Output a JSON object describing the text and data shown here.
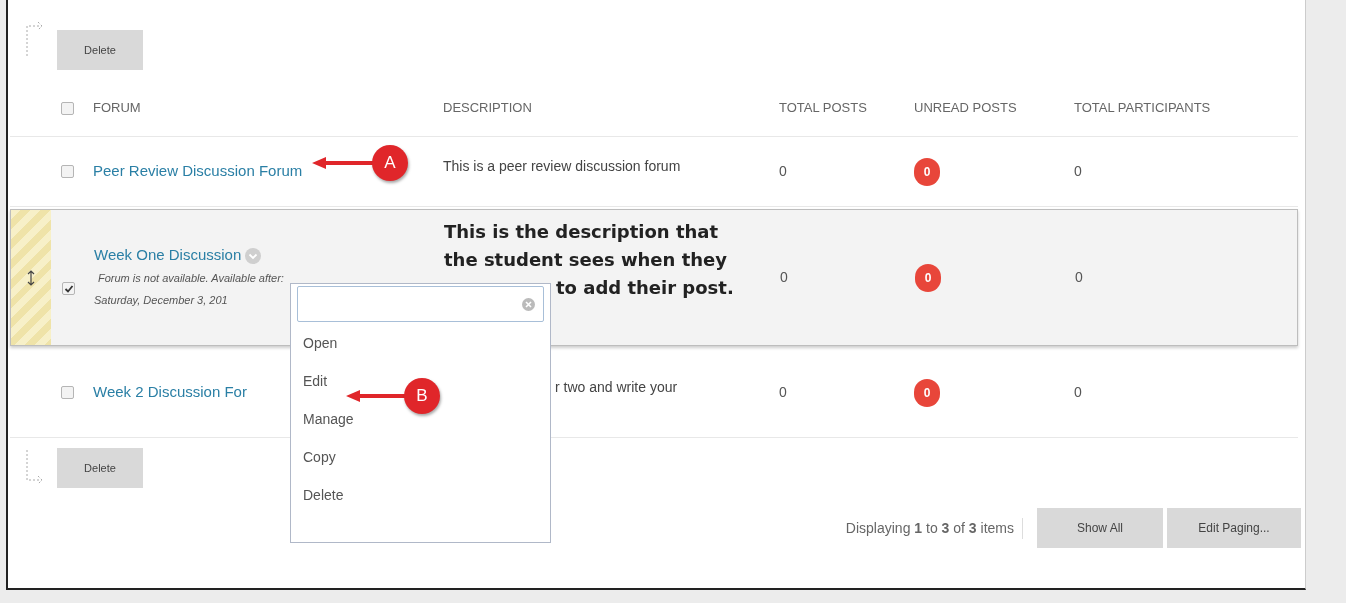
{
  "top_action": {
    "label": "Delete"
  },
  "table": {
    "select_all_checked": false,
    "columns": [
      "FORUM",
      "DESCRIPTION",
      "TOTAL POSTS",
      "UNREAD POSTS",
      "TOTAL PARTICIPANTS"
    ],
    "rows": [
      {
        "forum": "Peer Review Discussion Forum",
        "selected": false,
        "checked": false,
        "bold_description": false,
        "notes": [],
        "description": [
          {
            "text": "This is a peer review discussion forum",
            "covered": false
          }
        ],
        "total_posts": "0",
        "unread_posts": "0",
        "total_participants": "0"
      },
      {
        "forum": "Week One Discussion",
        "selected": true,
        "checked": true,
        "bold_description": true,
        "notes": [
          "Forum is not available. Available after:",
          "Saturday, December 3, 201"
        ],
        "description": [
          {
            "text": "This is the description that",
            "covered": false
          },
          {
            "text": "the student sees when they",
            "covered": false
          },
          {
            "text": "to add their post.",
            "covered": true
          }
        ],
        "total_posts": "0",
        "unread_posts": "0",
        "total_participants": "0"
      },
      {
        "forum": "Week 2 Discussion For",
        "selected": false,
        "checked": false,
        "bold_description": false,
        "notes": [],
        "description": [
          {
            "text": "r two and write your",
            "covered": true
          }
        ],
        "total_posts": "0",
        "unread_posts": "0",
        "total_participants": "0"
      }
    ]
  },
  "bottom_action": {
    "label": "Delete"
  },
  "paging": {
    "prefix": "Displaying",
    "from": "1",
    "to_word": "to",
    "to": "3",
    "of_word": "of",
    "total": "3",
    "suffix": "items",
    "buttons": [
      "Show All",
      "Edit Paging..."
    ]
  },
  "context_menu": {
    "items": [
      "Open",
      "Edit",
      "Manage",
      "Copy",
      "Delete"
    ]
  },
  "annotations": [
    {
      "label": "A"
    },
    {
      "label": "B"
    }
  ]
}
